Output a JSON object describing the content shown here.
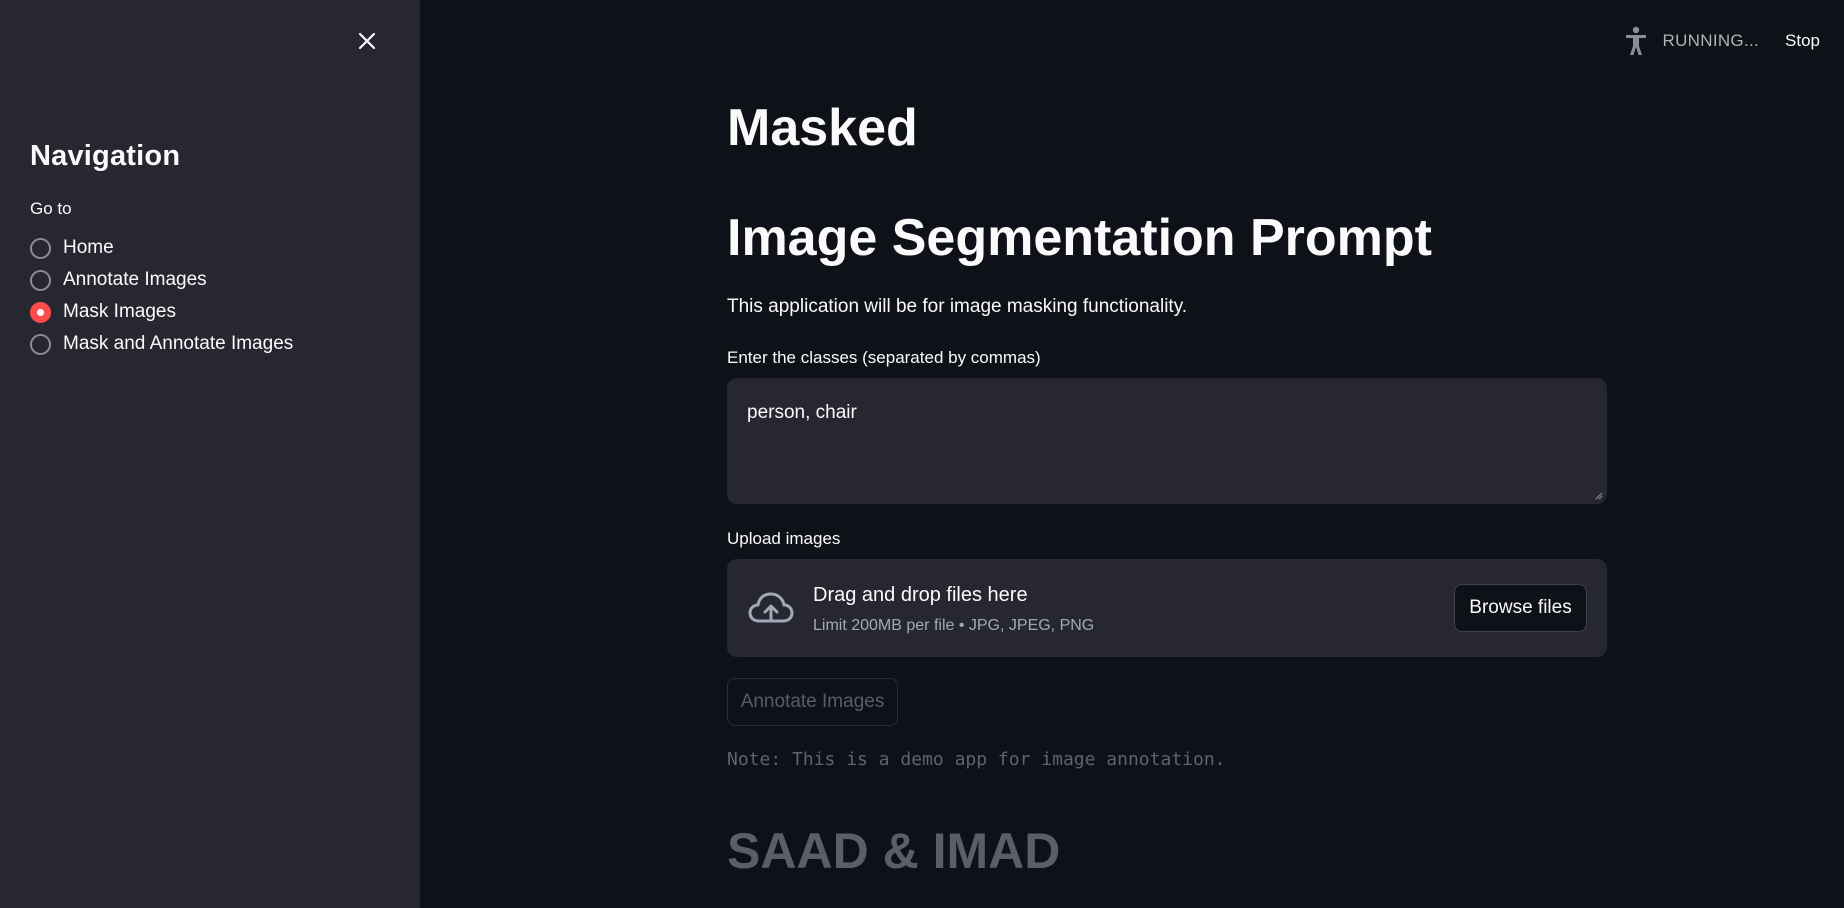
{
  "sidebar": {
    "close_icon": "close-icon",
    "heading": "Navigation",
    "radio_label": "Go to",
    "options": [
      {
        "label": "Home",
        "selected": false
      },
      {
        "label": "Annotate Images",
        "selected": false
      },
      {
        "label": "Mask Images",
        "selected": true
      },
      {
        "label": "Mask and Annotate Images",
        "selected": false
      }
    ]
  },
  "header": {
    "status_icon": "running-man-icon",
    "status_text": "RUNNING...",
    "stop_label": "Stop"
  },
  "main": {
    "title": "Masked",
    "subtitle": "Image Segmentation Prompt",
    "description": "This application will be for image masking functionality.",
    "classes_label": "Enter the classes (separated by commas)",
    "classes_value": "person, chair",
    "upload_label": "Upload images",
    "upload_icon": "cloud-upload-icon",
    "drag_text": "Drag and drop files here",
    "limit_text": "Limit 200MB per file • JPG, JPEG, PNG",
    "browse_label": "Browse files",
    "annotate_label": "Annotate Images",
    "note": "Note: This is a demo app for image annotation.",
    "footer_title": "SAAD & IMAD"
  },
  "colors": {
    "background": "#0e1117",
    "sidebar": "#262730",
    "accent": "#ff4b4b",
    "text": "#fafafa"
  }
}
